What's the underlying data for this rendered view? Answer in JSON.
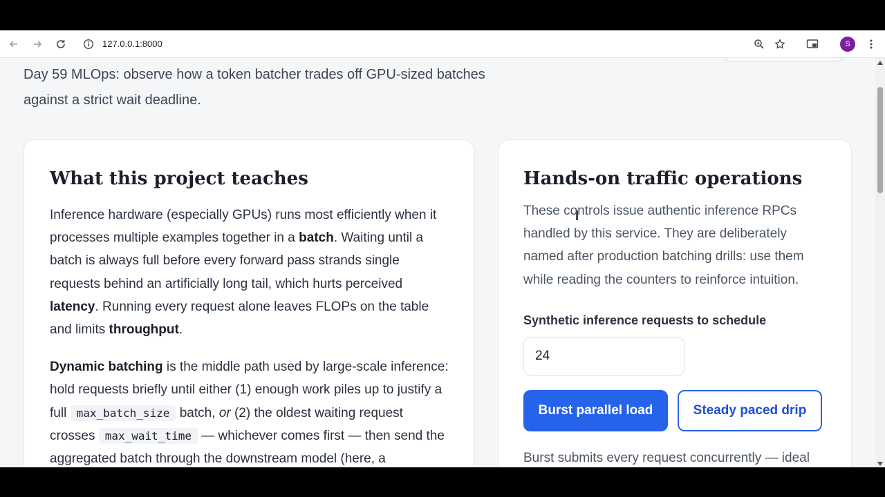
{
  "browser": {
    "url": "127.0.0.1:8000",
    "profile_initial": "S"
  },
  "intro": {
    "text": "Day 59 MLOps: observe how a token batcher trades off GPU-sized batches against a strict wait deadline."
  },
  "left_card": {
    "title": "What this project teaches",
    "p1": {
      "t1": "Inference hardware (especially GPUs) runs most efficiently when it processes multiple examples together in a ",
      "b1": "batch",
      "t2": ". Waiting until a batch is always full before every forward pass strands single requests behind an artificially long tail, which hurts perceived ",
      "b2": "latency",
      "t3": ". Running every request alone leaves FLOPs on the table and limits ",
      "b3": "throughput",
      "t4": "."
    },
    "p2": {
      "b1": "Dynamic batching",
      "t1": " is the middle path used by large-scale inference: hold requests briefly until either (1) enough work piles up to justify a full ",
      "c1": "max_batch_size",
      "t2": " batch, ",
      "i1": "or",
      "t3": " (2) the oldest waiting request crosses ",
      "c2": "max_wait_time",
      "t4": " — whichever comes first — then send the aggregated batch through the downstream model (here, a"
    }
  },
  "right_card": {
    "title": "Hands-on traffic operations",
    "description": "These controls issue authentic inference RPCs handled by this service. They are deliberately named after production batching drills: use them while reading the counters to reinforce intuition.",
    "field_label": "Synthetic inference requests to schedule",
    "field_value": "24",
    "burst_label": "Burst parallel load",
    "steady_label": "Steady paced drip",
    "footer_text": "Burst submits every request concurrently — ideal for"
  },
  "icons": {
    "back": "arrow-left-icon",
    "forward": "arrow-right-icon",
    "reload": "reload-icon",
    "info": "info-icon",
    "zoom": "zoom-icon",
    "bookmark": "star-icon",
    "cast": "cast-icon",
    "menu": "kebab-menu-icon"
  },
  "colors": {
    "accent": "#2563eb",
    "page_bg": "#f4f6f8",
    "profile": "#7b1fa2"
  }
}
